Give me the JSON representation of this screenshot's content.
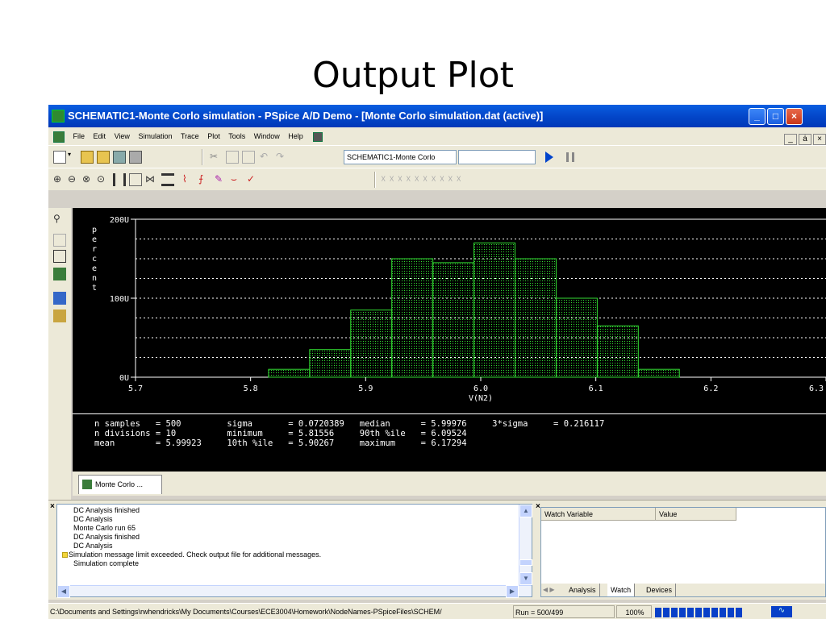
{
  "slide": {
    "title": "Output Plot"
  },
  "window": {
    "title": "SCHEMATIC1-Monte Corlo simulation - PSpice A/D Demo  - [Monte Corlo simulation.dat (active)]",
    "controls": {
      "minimize": "_",
      "maximize": "□",
      "close": "×"
    }
  },
  "menu": {
    "items": [
      "File",
      "Edit",
      "View",
      "Simulation",
      "Trace",
      "Plot",
      "Tools",
      "Window",
      "Help"
    ],
    "mdi_controls": [
      "_",
      "ȧ",
      "×"
    ]
  },
  "toolbar": {
    "profile_combo": "SCHEMATIC1-Monte Corlo",
    "profile_second_combo": ""
  },
  "plot": {
    "y_axis_title_letters": [
      "p",
      "e",
      "r",
      "c",
      "e",
      "n",
      "t"
    ],
    "x_axis_label": "V(N2)",
    "colors": {
      "background": "#000000",
      "bar_outline": "#33dd33",
      "grid": "#ffffff",
      "text": "#ffffff"
    }
  },
  "chart_data": {
    "type": "bar",
    "title": "",
    "xlabel": "V(N2)",
    "ylabel": "percent",
    "x_ticks": [
      "5.7",
      "5.8",
      "5.9",
      "6.0",
      "6.1",
      "6.2",
      "6.3"
    ],
    "y_ticks": [
      "0U",
      "100U",
      "200U"
    ],
    "xlim": [
      5.7,
      6.3
    ],
    "ylim": [
      0,
      200
    ],
    "bin_edges": [
      5.8156,
      5.8513,
      5.887,
      5.9227,
      5.9584,
      5.9941,
      6.0298,
      6.0655,
      6.1012,
      6.1369,
      6.1726
    ],
    "values": [
      10,
      35,
      85,
      150,
      145,
      170,
      150,
      100,
      65,
      10
    ]
  },
  "stats": {
    "n_samples_label": "n samples",
    "n_samples": "500",
    "n_divisions_label": "n divisions",
    "n_divisions": "10",
    "mean_label": "mean",
    "mean": "5.99923",
    "sigma_label": "sigma",
    "sigma": "0.0720389",
    "minimum_label": "minimum",
    "minimum": "5.81556",
    "p10_label": "10th %ile",
    "p10": "5.90267",
    "median_label": "median",
    "median": "5.99976",
    "p90_label": "90th %ile",
    "p90": "6.09524",
    "maximum_label": "maximum",
    "maximum": "6.17294",
    "three_sigma_label": "3*sigma",
    "three_sigma": "0.216117"
  },
  "plot_tab": {
    "label": "Monte Corlo ..."
  },
  "output": {
    "lines": [
      "DC Analysis finished",
      "DC Analysis",
      "Monte Carlo run 65",
      "DC Analysis finished",
      "DC Analysis",
      "Simulation message limit exceeded.  Check output file for additional messages.",
      "Simulation complete"
    ]
  },
  "watch": {
    "col_variable": "Watch Variable",
    "col_value": "Value",
    "tabs": [
      "Analysis",
      "Watch",
      "Devices"
    ]
  },
  "status": {
    "path": "C:\\Documents and Settings\\rwhendricks\\My Documents\\Courses\\ECE3004\\Homework\\NodeNames-PSpiceFiles\\SCHEM/",
    "run": "Run = 500/499",
    "zoom": "100%",
    "progress": 1.0
  }
}
